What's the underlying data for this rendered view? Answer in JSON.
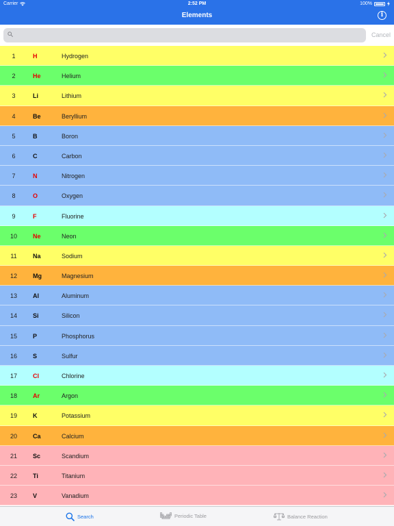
{
  "status_bar": {
    "carrier": "Carrier",
    "time": "2:52 PM",
    "battery": "100%"
  },
  "nav": {
    "title": "Elements",
    "info_icon": "info-icon"
  },
  "search": {
    "placeholder": "",
    "cancel_label": "Cancel"
  },
  "colors": {
    "brand": "#2a72e8",
    "yellow": "#ffff66",
    "green": "#6bff6b",
    "orange": "#ffb33d",
    "blue": "#8fbbf7",
    "cyan": "#b3ffff",
    "pink": "#ffb3b8",
    "symbol_red": "#e60000",
    "symbol_black": "#111111"
  },
  "elements": [
    {
      "number": "1",
      "symbol": "H",
      "name": "Hydrogen",
      "bg": "#ffff66",
      "symbol_color": "#e60000"
    },
    {
      "number": "2",
      "symbol": "He",
      "name": "Helium",
      "bg": "#6bff6b",
      "symbol_color": "#e60000"
    },
    {
      "number": "3",
      "symbol": "Li",
      "name": "Lithium",
      "bg": "#ffff66",
      "symbol_color": "#111111"
    },
    {
      "number": "4",
      "symbol": "Be",
      "name": "Beryllium",
      "bg": "#ffb33d",
      "symbol_color": "#111111"
    },
    {
      "number": "5",
      "symbol": "B",
      "name": "Boron",
      "bg": "#8fbbf7",
      "symbol_color": "#111111"
    },
    {
      "number": "6",
      "symbol": "C",
      "name": "Carbon",
      "bg": "#8fbbf7",
      "symbol_color": "#111111"
    },
    {
      "number": "7",
      "symbol": "N",
      "name": "Nitrogen",
      "bg": "#8fbbf7",
      "symbol_color": "#e60000"
    },
    {
      "number": "8",
      "symbol": "O",
      "name": "Oxygen",
      "bg": "#8fbbf7",
      "symbol_color": "#e60000"
    },
    {
      "number": "9",
      "symbol": "F",
      "name": "Fluorine",
      "bg": "#b3ffff",
      "symbol_color": "#e60000"
    },
    {
      "number": "10",
      "symbol": "Ne",
      "name": "Neon",
      "bg": "#6bff6b",
      "symbol_color": "#e60000"
    },
    {
      "number": "11",
      "symbol": "Na",
      "name": "Sodium",
      "bg": "#ffff66",
      "symbol_color": "#111111"
    },
    {
      "number": "12",
      "symbol": "Mg",
      "name": "Magnesium",
      "bg": "#ffb33d",
      "symbol_color": "#111111"
    },
    {
      "number": "13",
      "symbol": "Al",
      "name": "Aluminum",
      "bg": "#8fbbf7",
      "symbol_color": "#111111"
    },
    {
      "number": "14",
      "symbol": "Si",
      "name": "Silicon",
      "bg": "#8fbbf7",
      "symbol_color": "#111111"
    },
    {
      "number": "15",
      "symbol": "P",
      "name": "Phosphorus",
      "bg": "#8fbbf7",
      "symbol_color": "#111111"
    },
    {
      "number": "16",
      "symbol": "S",
      "name": "Sulfur",
      "bg": "#8fbbf7",
      "symbol_color": "#111111"
    },
    {
      "number": "17",
      "symbol": "Cl",
      "name": "Chlorine",
      "bg": "#b3ffff",
      "symbol_color": "#e60000"
    },
    {
      "number": "18",
      "symbol": "Ar",
      "name": "Argon",
      "bg": "#6bff6b",
      "symbol_color": "#e60000"
    },
    {
      "number": "19",
      "symbol": "K",
      "name": "Potassium",
      "bg": "#ffff66",
      "symbol_color": "#111111"
    },
    {
      "number": "20",
      "symbol": "Ca",
      "name": "Calcium",
      "bg": "#ffb33d",
      "symbol_color": "#111111"
    },
    {
      "number": "21",
      "symbol": "Sc",
      "name": "Scandium",
      "bg": "#ffb3b8",
      "symbol_color": "#111111"
    },
    {
      "number": "22",
      "symbol": "Ti",
      "name": "Titanium",
      "bg": "#ffb3b8",
      "symbol_color": "#111111"
    },
    {
      "number": "23",
      "symbol": "V",
      "name": "Vanadium",
      "bg": "#ffb3b8",
      "symbol_color": "#111111"
    }
  ],
  "tabs": [
    {
      "label": "Search",
      "icon": "magnifier-icon",
      "active": true
    },
    {
      "label": "Periodic Table",
      "icon": "periodic-grid-icon",
      "active": false
    },
    {
      "label": "Balance Reaction",
      "icon": "balance-scale-icon",
      "active": false
    }
  ]
}
